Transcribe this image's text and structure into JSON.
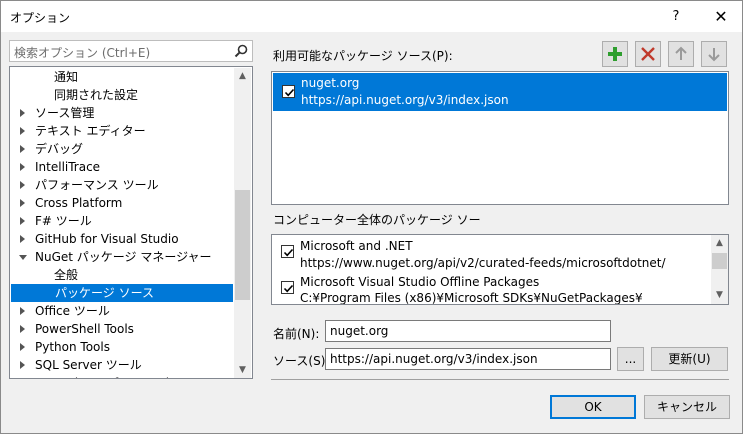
{
  "window": {
    "title": "オプション",
    "help_label": "?",
    "close_label": "✕"
  },
  "search": {
    "placeholder": "検索オプション (Ctrl+E)"
  },
  "tree": {
    "items": [
      {
        "label": "通知",
        "expander": "none",
        "indent": 2
      },
      {
        "label": "同期された設定",
        "expander": "none",
        "indent": 2
      },
      {
        "label": "ソース管理",
        "expander": "collapsed",
        "indent": 1
      },
      {
        "label": "テキスト エディター",
        "expander": "collapsed",
        "indent": 1
      },
      {
        "label": "デバッグ",
        "expander": "collapsed",
        "indent": 1
      },
      {
        "label": "IntelliTrace",
        "expander": "collapsed",
        "indent": 1
      },
      {
        "label": "パフォーマンス ツール",
        "expander": "collapsed",
        "indent": 1
      },
      {
        "label": "Cross Platform",
        "expander": "collapsed",
        "indent": 1
      },
      {
        "label": "F# ツール",
        "expander": "collapsed",
        "indent": 1
      },
      {
        "label": "GitHub for Visual Studio",
        "expander": "collapsed",
        "indent": 1
      },
      {
        "label": "NuGet パッケージ マネージャー",
        "expander": "expanded",
        "indent": 1
      },
      {
        "label": "全般",
        "expander": "none",
        "indent": 2
      },
      {
        "label": "パッケージ ソース",
        "expander": "none",
        "indent": 2,
        "selected": true
      },
      {
        "label": "Office ツール",
        "expander": "collapsed",
        "indent": 1
      },
      {
        "label": "PowerShell Tools",
        "expander": "collapsed",
        "indent": 1
      },
      {
        "label": "Python Tools",
        "expander": "collapsed",
        "indent": 1
      },
      {
        "label": "SQL Server ツール",
        "expander": "collapsed",
        "indent": 1
      },
      {
        "label": "Test Adapter for Google Test",
        "expander": "collapsed",
        "indent": 1
      }
    ]
  },
  "available_sources": {
    "label": "利用可能なパッケージ ソース(P):",
    "items": [
      {
        "name": "nuget.org",
        "url": "https://api.nuget.org/v3/index.json",
        "checked": true
      }
    ]
  },
  "toolbar": {
    "add_label": "add",
    "remove_label": "remove",
    "up_label": "move up",
    "down_label": "move down",
    "add_color": "#2e9e2e",
    "remove_color": "#c0392b"
  },
  "machine_sources": {
    "label": "コンピューター全体のパッケージ ソー",
    "items": [
      {
        "name": "Microsoft and .NET",
        "url": "https://www.nuget.org/api/v2/curated-feeds/microsoftdotnet/",
        "checked": true
      },
      {
        "name": "Microsoft Visual Studio Offline Packages",
        "url": "C:¥Program Files (x86)¥Microsoft SDKs¥NuGetPackages¥",
        "checked": true
      }
    ]
  },
  "form": {
    "name_label": "名前(N):",
    "name_value": "nuget.org",
    "source_label": "ソース(S):",
    "source_value": "https://api.nuget.org/v3/index.json",
    "browse_label": "...",
    "update_label": "更新(U)"
  },
  "footer": {
    "ok_label": "OK",
    "cancel_label": "キャンセル"
  },
  "colors": {
    "selection": "#0078d7",
    "dialog_bg": "#f0f0f0"
  }
}
